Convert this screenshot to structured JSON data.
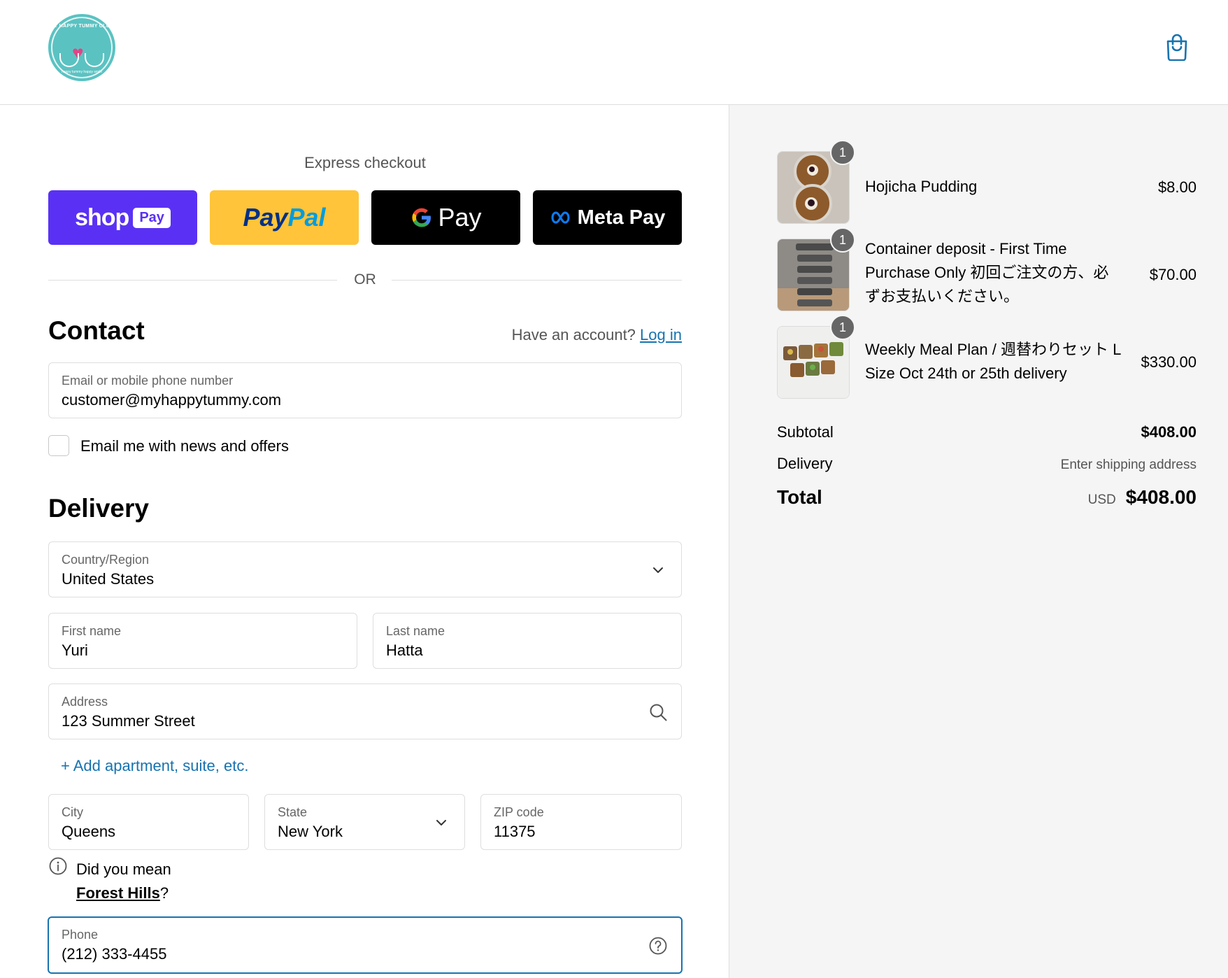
{
  "header": {
    "logo_text": "MY HAPPY TUMMY CLUB",
    "logo_subtext": "happy tummy happy smile"
  },
  "express": {
    "title": "Express checkout",
    "buttons": {
      "shop_pay": "shop",
      "shop_pay_badge": "Pay",
      "paypal_a": "Pay",
      "paypal_b": "Pal",
      "gpay": "Pay",
      "meta_pay": "Meta Pay"
    },
    "or_label": "OR"
  },
  "contact": {
    "title": "Contact",
    "account_prompt": "Have an account?",
    "login_label": "Log in",
    "email": {
      "label": "Email or mobile phone number",
      "value": "customer@myhappytummy.com"
    },
    "newsletter_label": "Email me with news and offers"
  },
  "delivery": {
    "title": "Delivery",
    "country": {
      "label": "Country/Region",
      "value": "United States"
    },
    "first_name": {
      "label": "First name",
      "value": "Yuri"
    },
    "last_name": {
      "label": "Last name",
      "value": "Hatta"
    },
    "address": {
      "label": "Address",
      "value": "123 Summer Street"
    },
    "add_apartment": "+ Add apartment, suite, etc.",
    "city": {
      "label": "City",
      "value": "Queens"
    },
    "state": {
      "label": "State",
      "value": "New York"
    },
    "zip": {
      "label": "ZIP code",
      "value": "11375"
    },
    "suggestion": {
      "prefix": "Did you mean",
      "place": "Forest Hills",
      "suffix": "?"
    },
    "phone": {
      "label": "Phone",
      "value": "(212) 333-4455"
    }
  },
  "summary": {
    "items": [
      {
        "name": "Hojicha Pudding",
        "price": "$8.00",
        "qty": "1"
      },
      {
        "name": "Container deposit - First Time Purchase Only 初回ご注文の方、必ずお支払いください。",
        "price": "$70.00",
        "qty": "1"
      },
      {
        "name": "Weekly Meal Plan / 週替わりセット L Size Oct 24th or 25th delivery",
        "price": "$330.00",
        "qty": "1"
      }
    ],
    "subtotal_label": "Subtotal",
    "subtotal_value": "$408.00",
    "delivery_label": "Delivery",
    "delivery_value": "Enter shipping address",
    "total_label": "Total",
    "total_currency": "USD",
    "total_value": "$408.00"
  },
  "colors": {
    "accent": "#1773b0",
    "shop_pay": "#5a31f4",
    "paypal": "#ffc439",
    "summary_bg": "#f5f5f5",
    "logo_teal": "#5bc2c2"
  }
}
